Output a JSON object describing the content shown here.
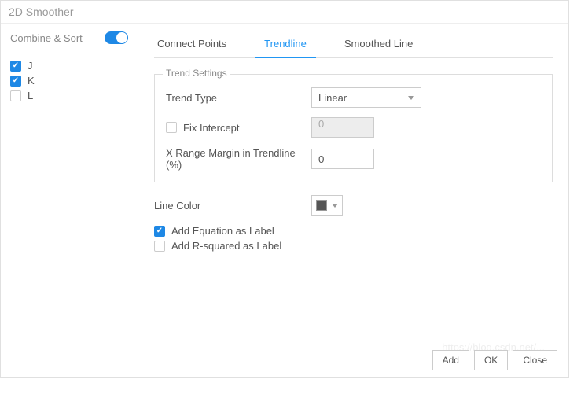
{
  "title": "2D Smoother",
  "sidebar": {
    "combine_sort": "Combine & Sort",
    "toggle_on": true,
    "items": [
      {
        "label": "J",
        "checked": true
      },
      {
        "label": "K",
        "checked": true
      },
      {
        "label": "L",
        "checked": false
      }
    ]
  },
  "tabs": {
    "connect": "Connect Points",
    "trendline": "Trendline",
    "smoothed": "Smoothed Line"
  },
  "trend": {
    "legend": "Trend Settings",
    "type_label": "Trend Type",
    "type_value": "Linear",
    "fix_intercept_label": "Fix Intercept",
    "fix_intercept_value": "0",
    "x_range_label": "X Range Margin in Trendline (%)",
    "x_range_value": "0"
  },
  "line_color_label": "Line Color",
  "eq_label": "Add Equation as Label",
  "r2_label": "Add R-squared as Label",
  "footer": {
    "add": "Add",
    "ok": "OK",
    "close": "Close"
  },
  "watermark": "https://blog.csdn.net/..."
}
